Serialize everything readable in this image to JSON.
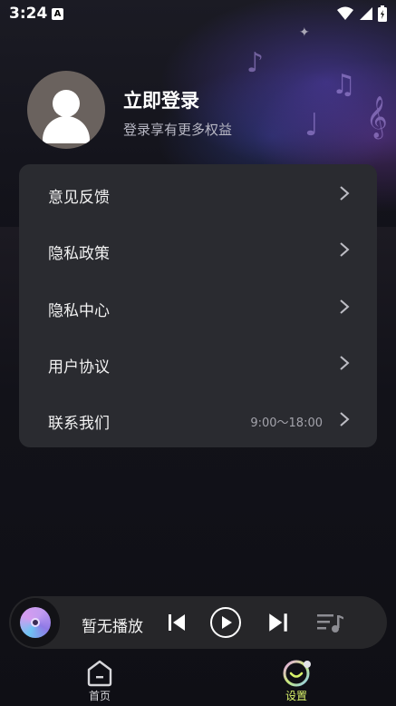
{
  "status_bar": {
    "time": "3:24",
    "notif_icon": "A"
  },
  "profile": {
    "title": "立即登录",
    "subtitle": "登录享有更多权益"
  },
  "menu": [
    {
      "label": "意见反馈",
      "extra": ""
    },
    {
      "label": "隐私政策",
      "extra": ""
    },
    {
      "label": "隐私中心",
      "extra": ""
    },
    {
      "label": "用户协议",
      "extra": ""
    },
    {
      "label": "联系我们",
      "extra": "9:00～18:00"
    }
  ],
  "player": {
    "status": "暂无播放"
  },
  "tabs": [
    {
      "label": "首页",
      "active": false
    },
    {
      "label": "设置",
      "active": true
    }
  ],
  "colors": {
    "accent": "#d8f26a",
    "card": "#2a2b30",
    "player": "#262629"
  }
}
